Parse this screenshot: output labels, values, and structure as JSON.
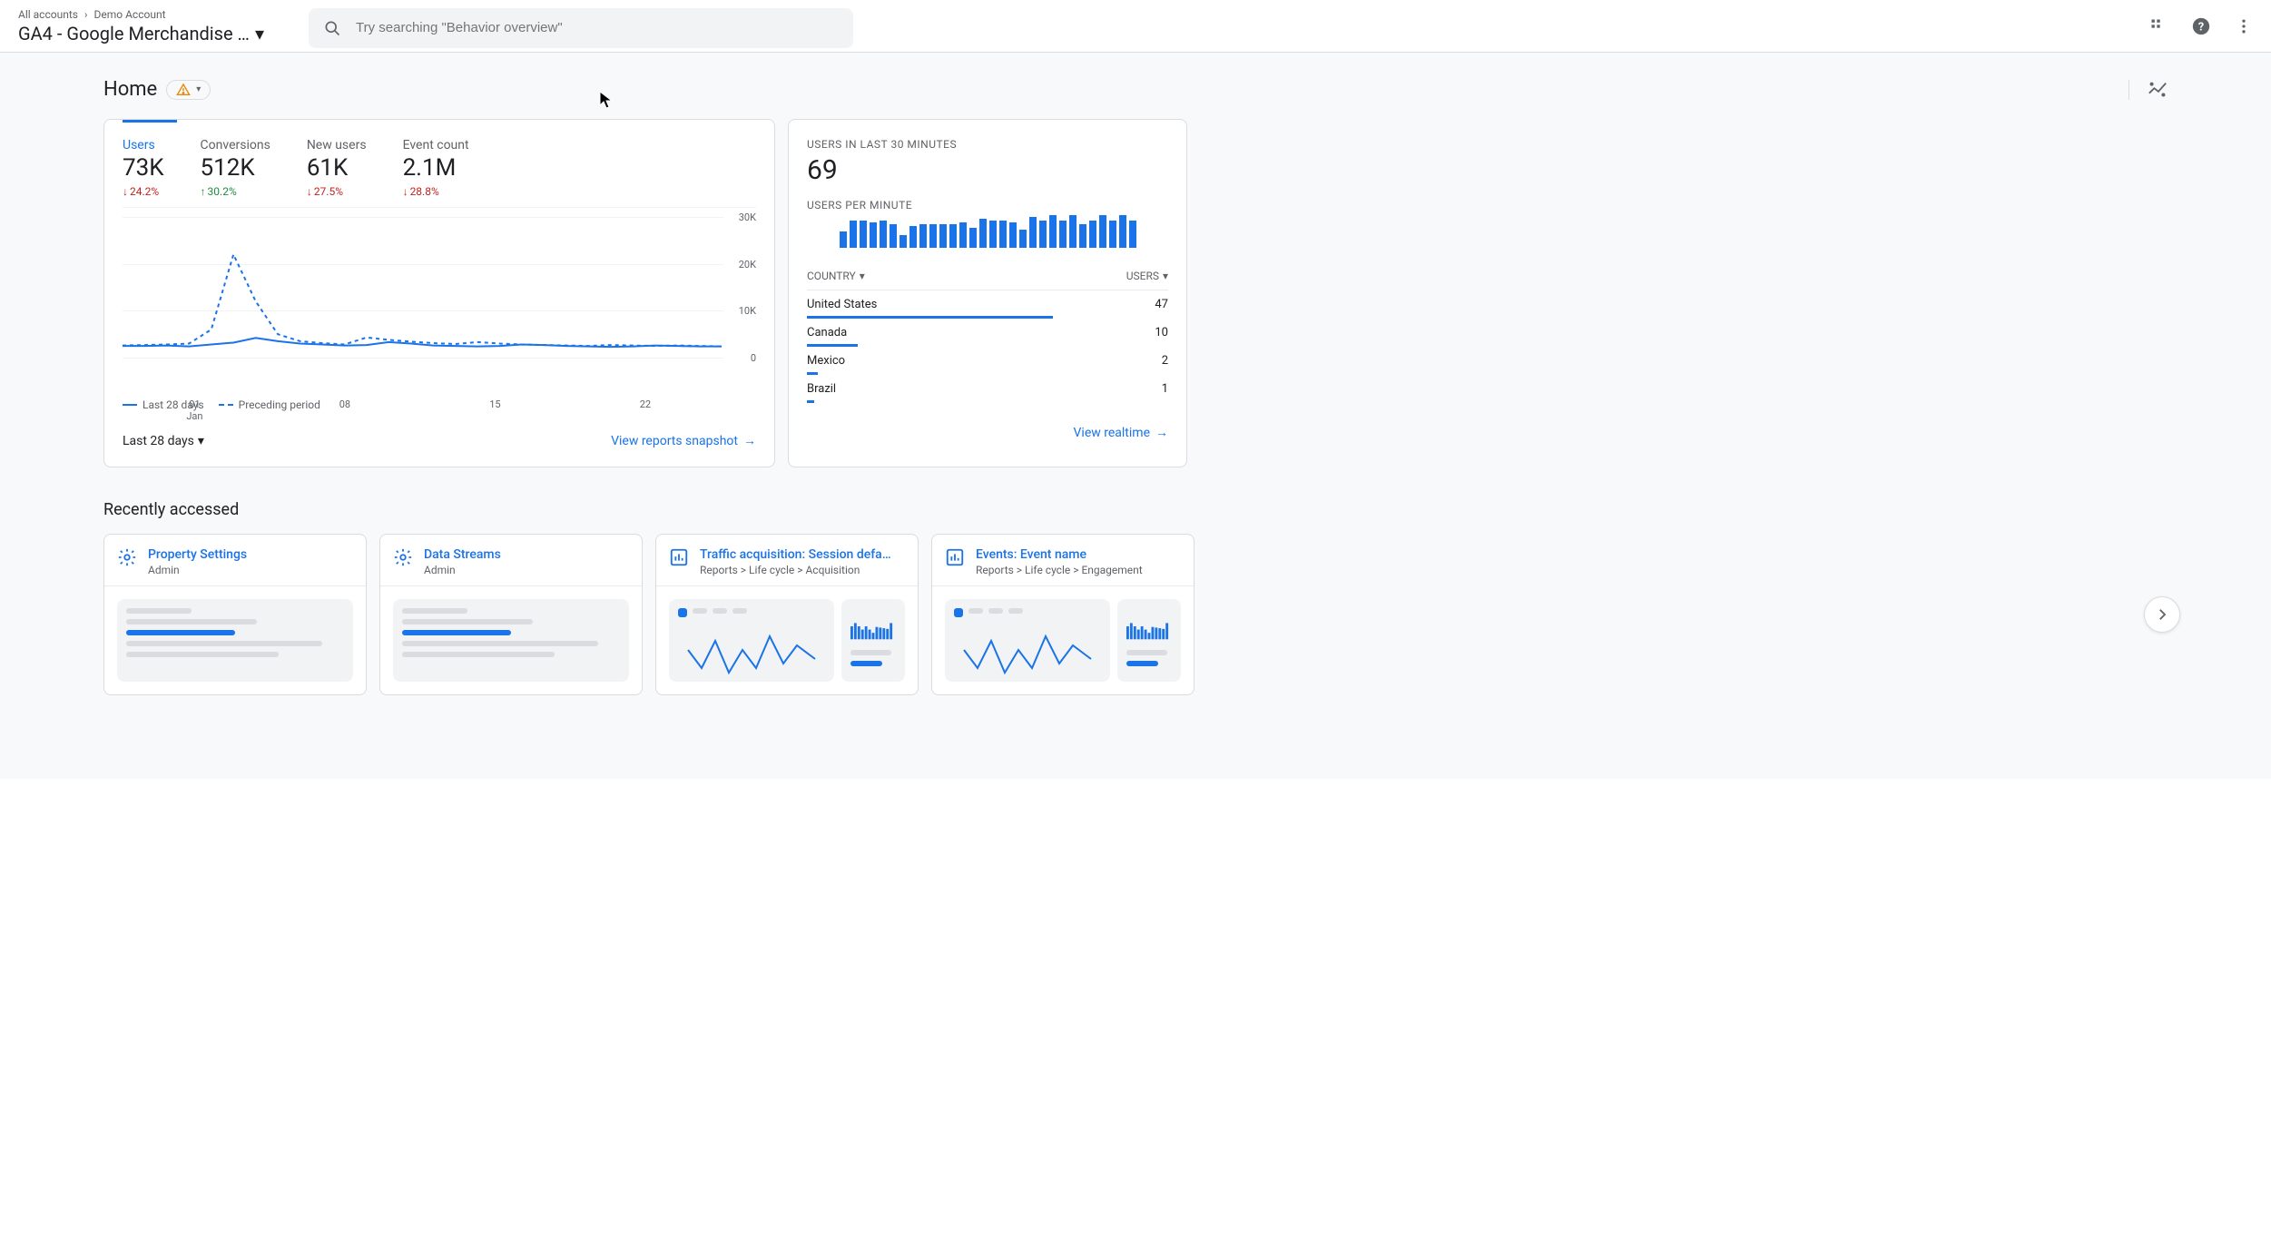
{
  "breadcrumb": {
    "all": "All accounts",
    "account": "Demo Account"
  },
  "property": "GA4 - Google Merchandise …",
  "search": {
    "placeholder": "Try searching \"Behavior overview\""
  },
  "page": {
    "title": "Home"
  },
  "overview": {
    "metrics": [
      {
        "label": "Users",
        "value": "73K",
        "delta": "24.2%",
        "dir": "down",
        "active": true
      },
      {
        "label": "Conversions",
        "value": "512K",
        "delta": "30.2%",
        "dir": "up",
        "active": false
      },
      {
        "label": "New users",
        "value": "61K",
        "delta": "27.5%",
        "dir": "down",
        "active": false
      },
      {
        "label": "Event count",
        "value": "2.1M",
        "delta": "28.8%",
        "dir": "down",
        "active": false
      }
    ],
    "legend": {
      "current": "Last 28 days",
      "compare": "Preceding period"
    },
    "date_range": "Last 28 days",
    "footer_link": "View reports snapshot"
  },
  "realtime": {
    "title": "USERS IN LAST 30 MINUTES",
    "value": "69",
    "subtitle": "USERS PER MINUTE",
    "table_head": {
      "country": "COUNTRY",
      "users": "USERS"
    },
    "rows": [
      {
        "country": "United States",
        "users": "47",
        "pct": 68
      },
      {
        "country": "Canada",
        "users": "10",
        "pct": 14
      },
      {
        "country": "Mexico",
        "users": "2",
        "pct": 3
      },
      {
        "country": "Brazil",
        "users": "1",
        "pct": 2
      }
    ],
    "footer_link": "View realtime"
  },
  "recently": {
    "title": "Recently accessed",
    "cards": [
      {
        "icon": "gear",
        "title": "Property Settings",
        "sub": "Admin"
      },
      {
        "icon": "gear",
        "title": "Data Streams",
        "sub": "Admin"
      },
      {
        "icon": "chart",
        "title": "Traffic acquisition: Session defa…",
        "sub": "Reports > Life cycle > Acquisition"
      },
      {
        "icon": "chart",
        "title": "Events: Event name",
        "sub": "Reports > Life cycle > Engagement"
      }
    ]
  },
  "chart_data": {
    "type": "line",
    "title": "",
    "xlabel": "",
    "ylabel": "",
    "ylim": [
      0,
      30000
    ],
    "y_ticks": [
      "0",
      "10K",
      "20K",
      "30K"
    ],
    "x_ticks": [
      {
        "pos": 12,
        "label": "01",
        "sub": "Jan"
      },
      {
        "pos": 37,
        "label": "08",
        "sub": ""
      },
      {
        "pos": 62,
        "label": "15",
        "sub": ""
      },
      {
        "pos": 87,
        "label": "22",
        "sub": ""
      }
    ],
    "series": [
      {
        "name": "Last 28 days",
        "style": "solid",
        "values": [
          2500,
          2500,
          2600,
          2400,
          2800,
          3200,
          4200,
          3500,
          3000,
          2800,
          2600,
          2700,
          3300,
          3000,
          2600,
          2500,
          2400,
          2500,
          2800,
          2700,
          2500,
          2400,
          2300,
          2400,
          2600,
          2500,
          2400,
          2400
        ]
      },
      {
        "name": "Preceding period",
        "style": "dashed",
        "values": [
          2600,
          2700,
          2800,
          3000,
          6000,
          22000,
          12000,
          5000,
          3500,
          3100,
          2800,
          4300,
          3800,
          3400,
          3100,
          2900,
          3300,
          3000,
          2800,
          2700,
          2600,
          2500,
          2700,
          2600,
          2500,
          2600,
          2500,
          2400
        ]
      }
    ]
  },
  "spark_data": {
    "type": "bar",
    "values": [
      18,
      30,
      30,
      28,
      30,
      26,
      14,
      24,
      26,
      26,
      26,
      26,
      28,
      22,
      32,
      30,
      30,
      28,
      20,
      34,
      30,
      36,
      30,
      36,
      26,
      30,
      36,
      30,
      36,
      30
    ]
  }
}
